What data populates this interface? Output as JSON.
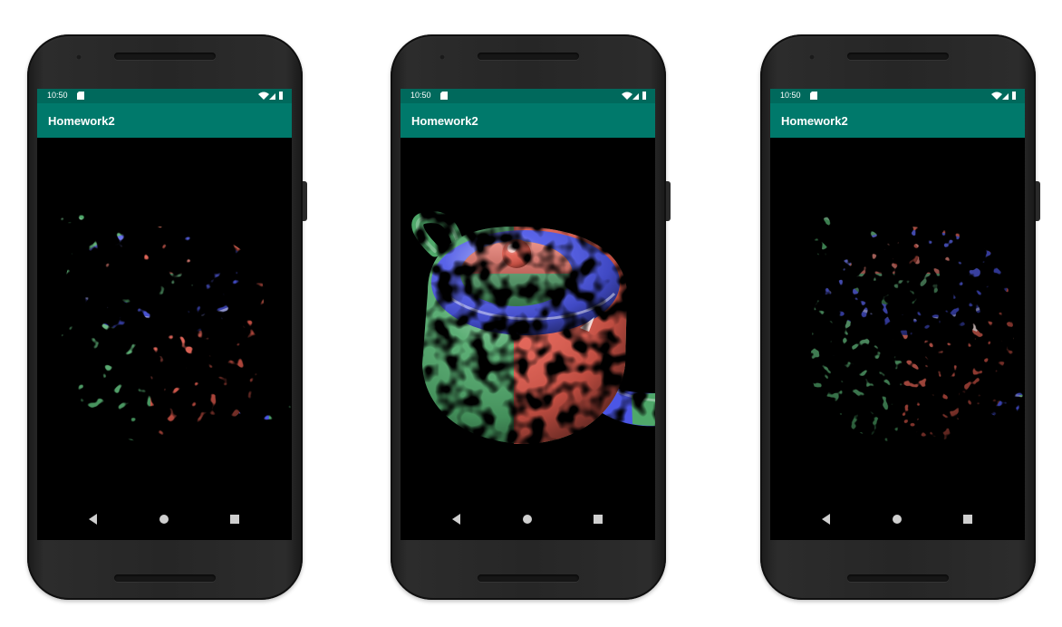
{
  "phones": [
    {
      "variant": "solid",
      "status": {
        "time": "10:50"
      },
      "app_bar": {
        "title": "Homework2"
      }
    },
    {
      "variant": "dissolving",
      "status": {
        "time": "10:50"
      },
      "app_bar": {
        "title": "Homework2"
      }
    },
    {
      "variant": "mostly-dissolved",
      "status": {
        "time": "10:50"
      },
      "app_bar": {
        "title": "Homework2"
      }
    }
  ],
  "icons": {
    "status": [
      "sd-card-icon",
      "wifi-icon",
      "signal-icon",
      "battery-icon"
    ],
    "navigation": [
      "back-icon",
      "home-icon",
      "recents-icon"
    ]
  },
  "colors": {
    "status_bar": "#00695c",
    "app_bar": "#00796b",
    "teapot_red": "#e05a4c",
    "teapot_green": "#4fa86a",
    "teapot_blue": "#4b56e6"
  }
}
